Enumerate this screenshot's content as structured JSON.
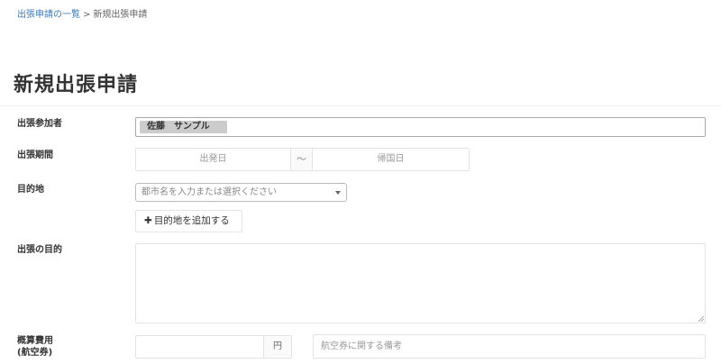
{
  "breadcrumb": {
    "parent_link": "出張申請の一覧",
    "separator": ">",
    "current": "新規出張申請"
  },
  "page_title": "新規出張申請",
  "form": {
    "participants": {
      "label": "出張参加者",
      "selected": [
        "佐藤　サンプル"
      ]
    },
    "period": {
      "label": "出張期間",
      "start_placeholder": "出発日",
      "separator": "～",
      "end_placeholder": "帰国日"
    },
    "destination": {
      "label": "目的地",
      "select_placeholder": "都市名を入力または選択ください",
      "add_button_label": "目的地を追加する",
      "add_button_icon": "plus-icon"
    },
    "purpose": {
      "label": "出張の目的",
      "value": ""
    },
    "estimated_cost": {
      "label_line1": "概算費用",
      "label_line2": "(航空券)",
      "unit": "円",
      "remark_placeholder": "航空券に関する備考"
    }
  }
}
